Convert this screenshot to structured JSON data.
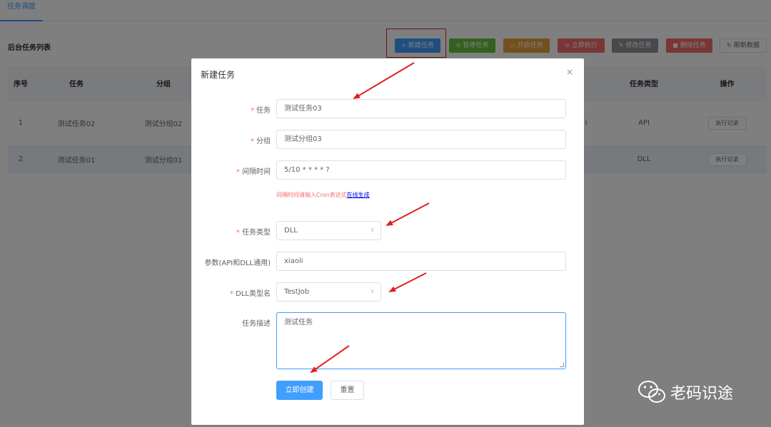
{
  "tab": {
    "label": "任务调度"
  },
  "list": {
    "title": "后台任务列表"
  },
  "toolbar": {
    "new_label": "新建任务",
    "pause_label": "暂停任务",
    "start_label": "开启任务",
    "run_label": "立即执行",
    "edit_label": "修改任务",
    "delete_label": "删除任务",
    "refresh_label": "刷新数据",
    "colors": {
      "new": "#409eff",
      "pause": "#67c23a",
      "start": "#e6a23c",
      "run": "#f56c6c",
      "edit": "#909399",
      "delete": "#f56c6c"
    }
  },
  "table": {
    "headers": {
      "idx": "序号",
      "task": "任务",
      "group": "分组",
      "type": "任务类型",
      "op": "操作"
    },
    "rows": [
      {
        "idx": "1",
        "task": "测试任务02",
        "group": "测试分组02",
        "frag": "i",
        "type": "API",
        "op": "执行记录"
      },
      {
        "idx": "2",
        "task": "测试任务01",
        "group": "测试分组01",
        "frag": "",
        "type": "DLL",
        "op": "执行记录"
      }
    ]
  },
  "dialog": {
    "title": "新建任务",
    "close": "×",
    "fields": {
      "task": {
        "label": "任务",
        "value": "测试任务03"
      },
      "group": {
        "label": "分组",
        "value": "测试分组03"
      },
      "interval": {
        "label": "间隔时间",
        "value": "5/10 * * * * ?"
      },
      "type": {
        "label": "任务类型",
        "value": "DLL"
      },
      "params": {
        "label": "参数(API和DLL通用)",
        "value": "xiaoli"
      },
      "dll": {
        "label": "DLL类型名",
        "value": "TestJob"
      },
      "desc": {
        "label": "任务描述",
        "value": "测试任务"
      }
    },
    "hint": {
      "text": "间隔时间请输入Cron表达式",
      "link": "在线生成"
    },
    "create_label": "立即创建",
    "reset_label": "重置",
    "required_mark": "*"
  },
  "watermark": {
    "text": "老码识途"
  }
}
